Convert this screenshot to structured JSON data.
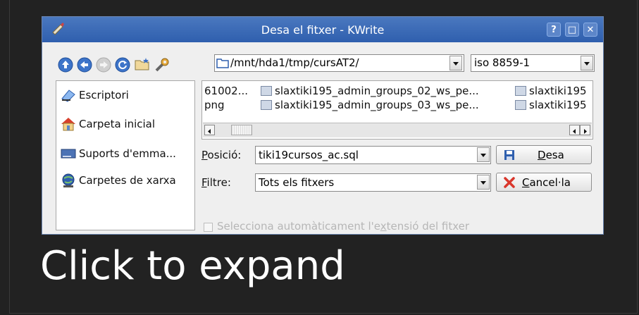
{
  "window": {
    "title": "Desa el fitxer - KWrite",
    "help_btn": "?",
    "max_btn": "□",
    "close_btn": "✕"
  },
  "toolbar": {
    "icons": [
      "go-up-icon",
      "go-back-icon",
      "go-forward-icon",
      "reload-icon",
      "new-folder-icon",
      "settings-icon"
    ],
    "path": "/mnt/hda1/tmp/cursAT2/",
    "encoding": "iso 8859-1"
  },
  "sidebar": {
    "items": [
      {
        "label": "Escriptori",
        "icon": "desktop-icon"
      },
      {
        "label": "Carpeta inicial",
        "icon": "home-icon"
      },
      {
        "label": "Suports d'emma...",
        "icon": "storage-icon"
      },
      {
        "label": "Carpetes de xarxa",
        "icon": "network-icon"
      }
    ]
  },
  "files": {
    "col1": [
      "61002...",
      "png"
    ],
    "col2": [
      "slaxtiki195_admin_groups_02_ws_pe...",
      "slaxtiki195_admin_groups_03_ws_pe..."
    ],
    "col3": [
      "slaxtiki195",
      "slaxtiki195"
    ]
  },
  "location": {
    "label_prefix": "",
    "label_u": "P",
    "label_rest": "osició:",
    "value": "tiki19cursos_ac.sql"
  },
  "filter": {
    "label_u": "F",
    "label_rest": "iltre:",
    "value": "Tots els fitxers"
  },
  "buttons": {
    "save_u": "D",
    "save_rest": "esa",
    "cancel_u": "C",
    "cancel_rest": "ancel·la"
  },
  "auto_ext": {
    "label_a": "Selecciona automàticament l'e",
    "label_u": "x",
    "label_b": "tensió del fitxer",
    "checked": false
  },
  "caption": "Click to expand",
  "colors": {
    "titlebar": "#3a6ab8",
    "background": "#222222",
    "dialog": "#efefef"
  }
}
